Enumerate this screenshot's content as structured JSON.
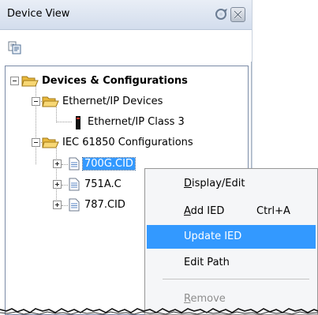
{
  "panel": {
    "title": "Device View"
  },
  "tree": {
    "root": "Devices & Configurations",
    "ethernet_group": "Ethernet/IP Devices",
    "ethernet_device": "Ethernet/IP Class 3",
    "iec_group": "IEC 61850 Configurations",
    "files": [
      "700G.CID",
      "751A.C",
      "787.CID"
    ]
  },
  "context_menu": {
    "items": [
      {
        "label": "Display/Edit",
        "shortcut": "",
        "state": "normal"
      },
      {
        "label": "Add IED",
        "shortcut": "Ctrl+A",
        "state": "normal"
      },
      {
        "label": "Update IED",
        "shortcut": "",
        "state": "highlighted"
      },
      {
        "label": "Edit Path",
        "shortcut": "",
        "state": "normal"
      },
      {
        "label": "Remove",
        "shortcut": "",
        "state": "disabled"
      }
    ]
  },
  "colors": {
    "selection": "#3399ff",
    "titlebar": "#dbe3ef"
  }
}
